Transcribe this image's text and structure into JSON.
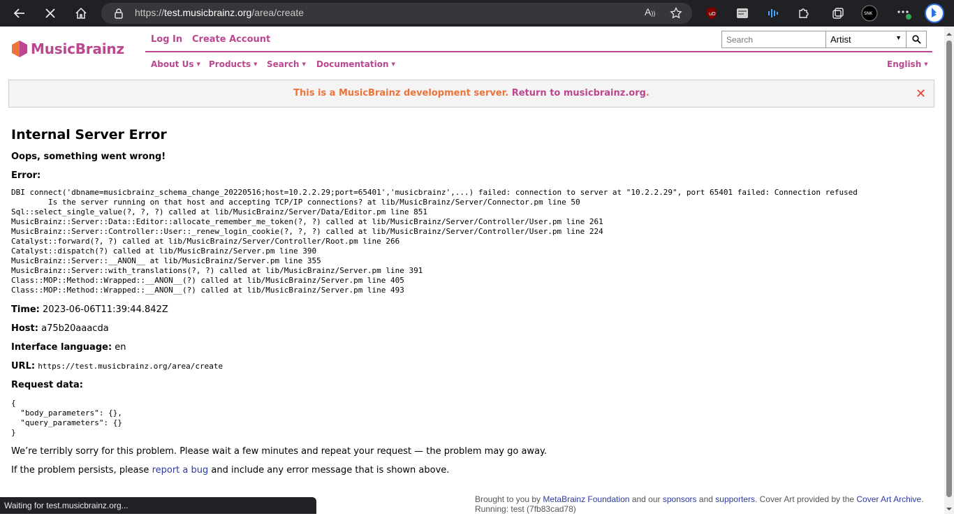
{
  "browser": {
    "url_prefix": "https://",
    "url_host": "test.musicbrainz.org",
    "url_path": "/area/create",
    "status_text": "Waiting for test.musicbrainz.org..."
  },
  "header": {
    "logo_text": "MusicBrainz",
    "login": "Log In",
    "create_account": "Create Account",
    "search_placeholder": "Search",
    "search_type": "Artist",
    "menu": [
      "About Us",
      "Products",
      "Search",
      "Documentation"
    ],
    "language": "English"
  },
  "banner": {
    "text": "This is a MusicBrainz development server. ",
    "link": "Return to musicbrainz.org",
    "suffix": "."
  },
  "error": {
    "title": "Internal Server Error",
    "subtitle": "Oops, something went wrong!",
    "error_label": "Error:",
    "trace": "DBI connect('dbname=musicbrainz_schema_change_20220516;host=10.2.2.29;port=65401','musicbrainz',...) failed: connection to server at \"10.2.2.29\", port 65401 failed: Connection refused\n        Is the server running on that host and accepting TCP/IP connections? at lib/MusicBrainz/Server/Connector.pm line 50\nSql::select_single_value(?, ?, ?) called at lib/MusicBrainz/Server/Data/Editor.pm line 851\nMusicBrainz::Server::Data::Editor::allocate_remember_me_token(?, ?) called at lib/MusicBrainz/Server/Controller/User.pm line 261\nMusicBrainz::Server::Controller::User::_renew_login_cookie(?, ?, ?) called at lib/MusicBrainz/Server/Controller/User.pm line 224\nCatalyst::forward(?, ?) called at lib/MusicBrainz/Server/Controller/Root.pm line 266\nCatalyst::dispatch(?) called at lib/MusicBrainz/Server.pm line 390\nMusicBrainz::Server::__ANON__ at lib/MusicBrainz/Server.pm line 355\nMusicBrainz::Server::with_translations(?, ?) called at lib/MusicBrainz/Server.pm line 391\nClass::MOP::Method::Wrapped::__ANON__(?) called at lib/MusicBrainz/Server.pm line 405\nClass::MOP::Method::Wrapped::__ANON__(?) called at lib/MusicBrainz/Server.pm line 493",
    "time_label": "Time:",
    "time": "2023-06-06T11:39:44.842Z",
    "host_label": "Host:",
    "host": "a75b20aaacda",
    "lang_label": "Interface language:",
    "lang": "en",
    "url_label": "URL:",
    "url": "https://test.musicbrainz.org/area/create",
    "request_label": "Request data:",
    "request_data": "{\n  \"body_parameters\": {},\n  \"query_parameters\": {}\n}",
    "sorry": "We’re terribly sorry for this problem. Please wait a few minutes and repeat your request — the problem may go away.",
    "persist_prefix": "If the problem persists, please ",
    "persist_link": "report a bug",
    "persist_suffix": " and include any error message that is shown above."
  },
  "footer": {
    "brought": "Brought to you by ",
    "metabrainz": "MetaBrainz Foundation",
    "and_our": " and our ",
    "sponsors": "sponsors",
    "and": " and ",
    "supporters": "supporters",
    "cover_art": ". Cover Art provided by the ",
    "caa": "Cover Art Archive",
    "end": ".",
    "running": "Running: test (7fb83cad78)"
  },
  "colors": {
    "brand": "#ba478f",
    "banner_text": "#eb743b",
    "link": "#2d3ba1",
    "close": "#e8412d"
  }
}
